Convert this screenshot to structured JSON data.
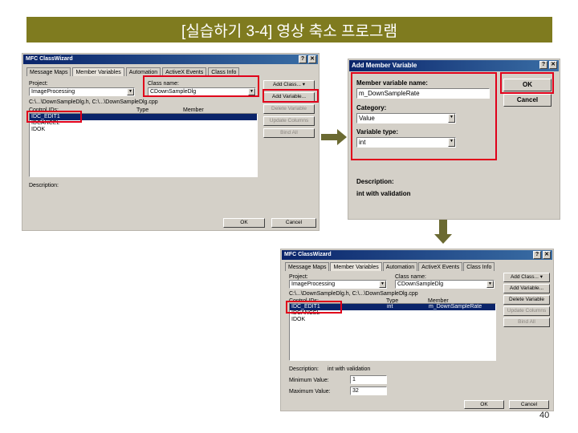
{
  "title": "[실습하기 3-4] 영상 축소 프로그램",
  "wizard1": {
    "window_title": "MFC ClassWizard",
    "tabs": [
      "Message Maps",
      "Member Variables",
      "Automation",
      "ActiveX Events",
      "Class Info"
    ],
    "project_label": "Project:",
    "project_value": "ImageProcessing",
    "class_name_label": "Class name:",
    "class_name_value": "CDownSampleDlg",
    "path": "C:\\...\\DownSampleDlg.h, C:\\...\\DownSampleDlg.cpp",
    "col_control_ids": "Control IDs:",
    "col_type": "Type",
    "col_member": "Member",
    "rows": [
      "IDC_EDIT1",
      "IDCANCEL",
      "IDOK"
    ],
    "buttons": [
      "Add Class...",
      "Add Variable...",
      "Delete Variable",
      "Update Columns",
      "Bind All"
    ],
    "description_label": "Description:",
    "ok": "OK",
    "cancel": "Cancel"
  },
  "add_member": {
    "window_title": "Add Member Variable",
    "name_label": "Member variable name:",
    "name_value": "m_DownSampleRate",
    "category_label": "Category:",
    "category_value": "Value",
    "type_label": "Variable type:",
    "type_value": "int",
    "description_label": "Description:",
    "description_value": "int with validation",
    "ok": "OK",
    "cancel": "Cancel"
  },
  "wizard2": {
    "window_title": "MFC ClassWizard",
    "tabs": [
      "Message Maps",
      "Member Variables",
      "Automation",
      "ActiveX Events",
      "Class Info"
    ],
    "project_label": "Project:",
    "project_value": "ImageProcessing",
    "class_name_label": "Class name:",
    "class_name_value": "CDownSampleDlg",
    "path": "C:\\...\\DownSampleDlg.h, C:\\...\\DownSampleDlg.cpp",
    "col_control_ids": "Control IDs:",
    "col_type": "Type",
    "col_member": "Member",
    "row1_id": "IDC_EDIT1",
    "row1_type": "int",
    "row1_member": "m_DownSampleRate",
    "row2_id": "IDCANCEL",
    "row3_id": "IDOK",
    "buttons": [
      "Add Class...",
      "Add Variable...",
      "Delete Variable",
      "Update Columns",
      "Bind All"
    ],
    "description_label": "Description:",
    "description_value": "int with validation",
    "min_label": "Minimum Value:",
    "min_value": "1",
    "max_label": "Maximum Value:",
    "max_value": "32",
    "ok": "OK",
    "cancel": "Cancel"
  },
  "page_number": "40"
}
